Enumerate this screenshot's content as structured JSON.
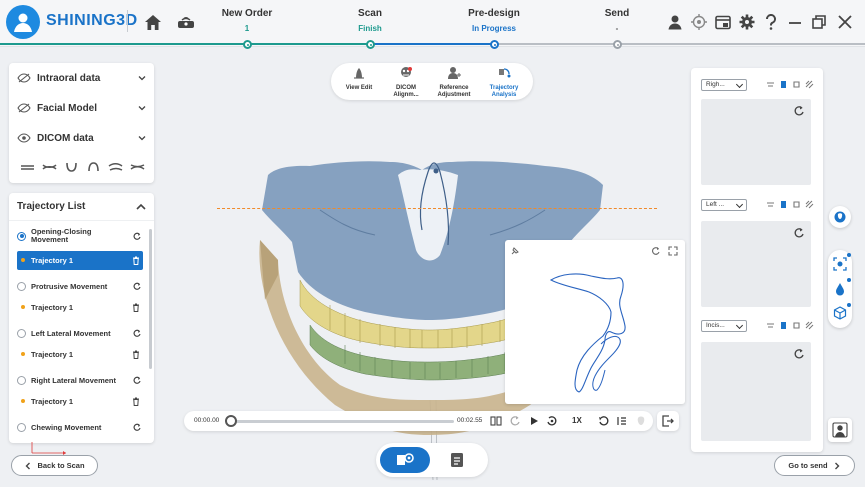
{
  "brand": {
    "name": "SHINING3D"
  },
  "steps": [
    {
      "label": "New Order",
      "status": "1"
    },
    {
      "label": "Scan",
      "status": "Finish"
    },
    {
      "label": "Pre-design",
      "status": "In Progress"
    },
    {
      "label": "Send",
      "status": "-"
    }
  ],
  "top_icons": [
    "home-icon",
    "scanner-icon"
  ],
  "right_tools": [
    "user-icon",
    "target-icon",
    "window-icon",
    "gear-icon",
    "help-icon",
    "minimize-icon",
    "restore-icon",
    "close-icon"
  ],
  "layers": [
    {
      "label": "Intraoral data",
      "icon": "eye-hidden-icon"
    },
    {
      "label": "Facial Model",
      "icon": "eye-hidden-icon"
    },
    {
      "label": "DICOM data",
      "icon": "eye-icon"
    }
  ],
  "trajectory_list": {
    "title": "Trajectory List",
    "movements": [
      {
        "label": "Opening-Closing Movement",
        "selected": true,
        "trajectory": "Trajectory 1",
        "trajectory_selected": true
      },
      {
        "label": "Protrusive Movement",
        "selected": false,
        "trajectory": "Trajectory 1",
        "trajectory_selected": false
      },
      {
        "label": "Left Lateral Movement",
        "selected": false,
        "trajectory": "Trajectory 1",
        "trajectory_selected": false
      },
      {
        "label": "Right Lateral Movement",
        "selected": false,
        "trajectory": "Trajectory 1",
        "trajectory_selected": false
      },
      {
        "label": "Chewing Movement",
        "selected": false
      }
    ]
  },
  "toolbar": {
    "tools": [
      {
        "label": "View Edit",
        "active": false
      },
      {
        "label": "DICOM Alignm...",
        "active": false
      },
      {
        "label": "Reference Adjustment",
        "active": false
      },
      {
        "label": "Trajectory Analysis",
        "active": true
      }
    ]
  },
  "playback": {
    "current_time": "00:00.00",
    "total_time": "00:02.55",
    "speed": "1X",
    "progress": 0
  },
  "views": [
    {
      "selected": "Righ..."
    },
    {
      "selected": "Left ..."
    },
    {
      "selected": "Incis..."
    }
  ],
  "navigation": {
    "back_label": "Back to Scan",
    "next_label": "Go to send"
  },
  "colors": {
    "accent": "#1a73c8",
    "finish": "#1d9a8e",
    "dash": "#f08a2a",
    "dot": "#f0a21a"
  }
}
